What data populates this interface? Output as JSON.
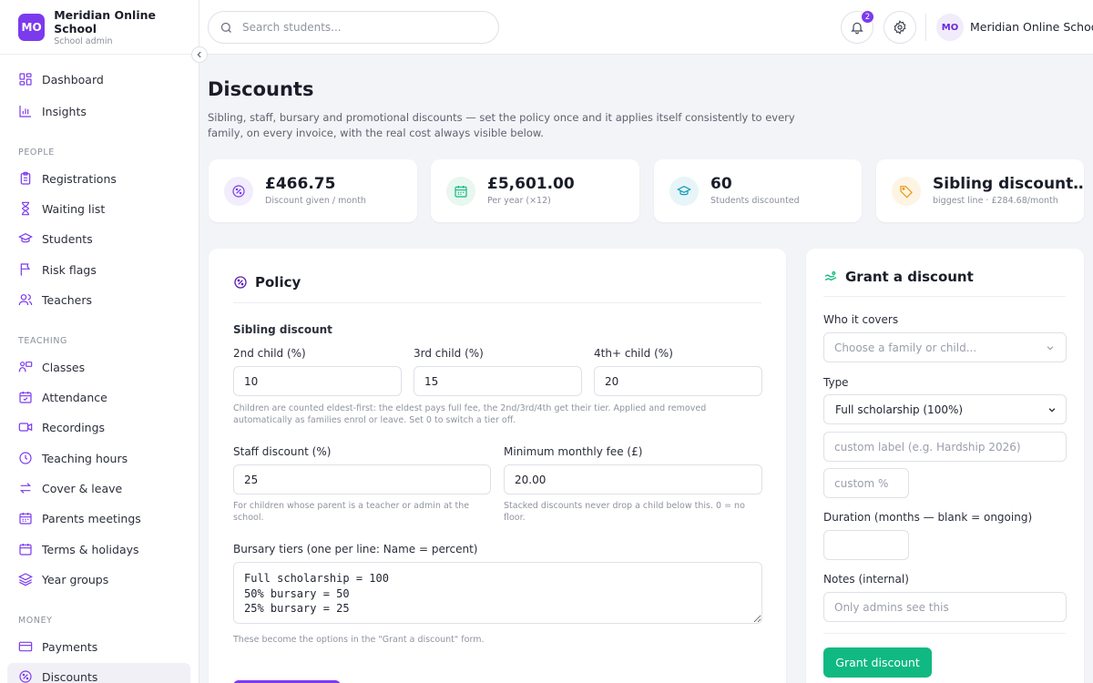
{
  "brand": {
    "initials": "MO",
    "name": "Meridian Online School",
    "role": "School admin"
  },
  "nav": {
    "dashboard": "Dashboard",
    "insights": "Insights",
    "section_people": "PEOPLE",
    "registrations": "Registrations",
    "waiting_list": "Waiting list",
    "students": "Students",
    "risk_flags": "Risk flags",
    "teachers": "Teachers",
    "section_teaching": "TEACHING",
    "classes": "Classes",
    "attendance": "Attendance",
    "recordings": "Recordings",
    "teaching_hours": "Teaching hours",
    "cover_leave": "Cover & leave",
    "parents_meetings": "Parents meetings",
    "terms_holidays": "Terms & holidays",
    "year_groups": "Year groups",
    "section_money": "MONEY",
    "payments": "Payments",
    "discounts": "Discounts",
    "active": "discounts"
  },
  "topbar": {
    "search_placeholder": "Search students...",
    "notifications_count": "2",
    "user_initials": "MO",
    "user_name": "Meridian Online School"
  },
  "page": {
    "title": "Discounts",
    "description": "Sibling, staff, bursary and promotional discounts — set the policy once and it applies itself consistently to every family, on every invoice, with the real cost always visible below."
  },
  "stats": [
    {
      "value": "£466.75",
      "label": "Discount given / month",
      "icon": "discount-icon"
    },
    {
      "value": "£5,601.00",
      "label": "Per year (×12)",
      "icon": "calendar-icon"
    },
    {
      "value": "60",
      "label": "Students discounted",
      "icon": "graduation-cap-icon"
    },
    {
      "value": "Sibling discount…",
      "label": "biggest line · £284.68/month",
      "icon": "tag-icon"
    }
  ],
  "policy": {
    "title": "Policy",
    "sibling_heading": "Sibling discount",
    "second_child_label": "2nd child (%)",
    "second_child_value": "10",
    "third_child_label": "3rd child (%)",
    "third_child_value": "15",
    "fourth_child_label": "4th+ child (%)",
    "fourth_child_value": "20",
    "sibling_help": "Children are counted eldest-first: the eldest pays full fee, the 2nd/3rd/4th get their tier. Applied and removed automatically as families enrol or leave. Set 0 to switch a tier off.",
    "staff_label": "Staff discount (%)",
    "staff_value": "25",
    "staff_help": "For children whose parent is a teacher or admin at the school.",
    "min_fee_label": "Minimum monthly fee (£)",
    "min_fee_value": "20.00",
    "min_fee_help": "Stacked discounts never drop a child below this. 0 = no floor.",
    "bursary_label": "Bursary tiers (one per line: Name = percent)",
    "bursary_value": "Full scholarship = 100\n50% bursary = 50\n25% bursary = 25",
    "bursary_help": "These become the options in the \"Grant a discount\" form."
  },
  "grant": {
    "title": "Grant a discount",
    "covers_label": "Who it covers",
    "covers_placeholder": "Choose a family or child...",
    "type_label": "Type",
    "type_value": "Full scholarship (100%)",
    "custom_label_placeholder": "custom label (e.g. Hardship 2026)",
    "custom_pct_placeholder": "custom %",
    "duration_label": "Duration (months — blank = ongoing)",
    "notes_label": "Notes (internal)",
    "notes_placeholder": "Only admins see this",
    "submit": "Grant discount"
  },
  "colors": {
    "accent": "#7c3aed",
    "success": "#10b981"
  }
}
